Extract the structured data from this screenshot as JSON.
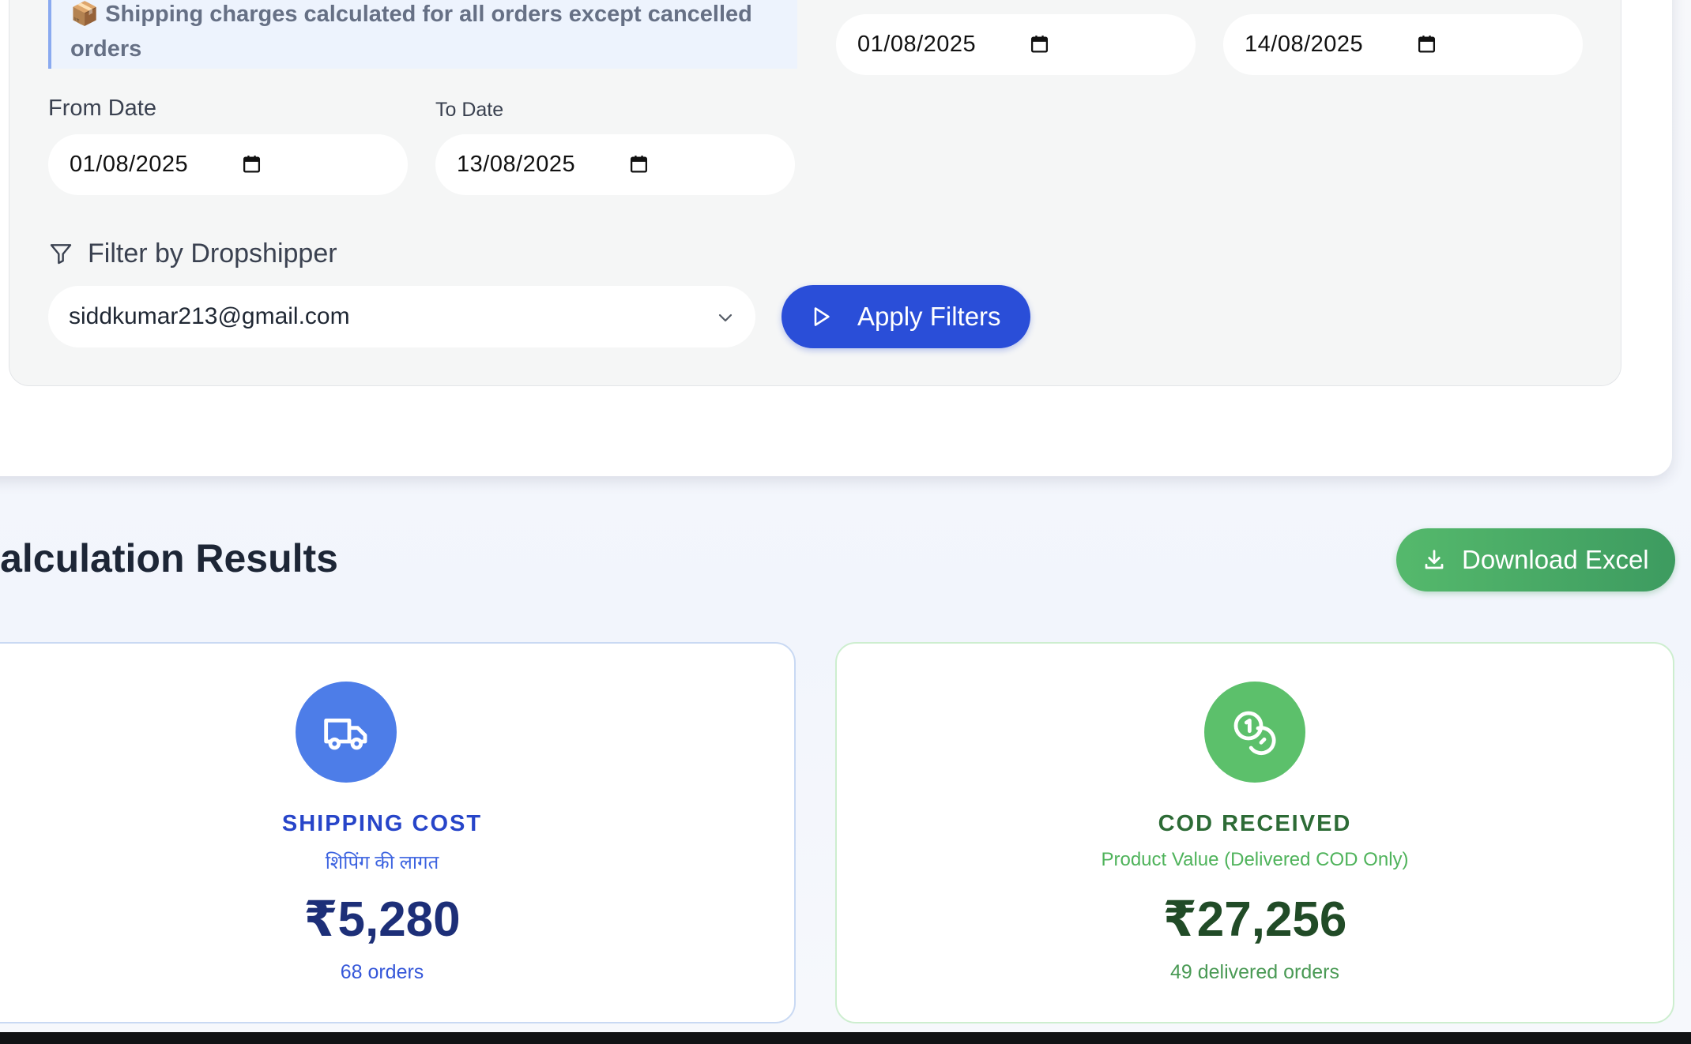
{
  "info_banner": {
    "text": "📦 Shipping charges calculated for all orders except cancelled orders"
  },
  "top_range": {
    "from_value": "01/08/2025",
    "to_value": "14/08/2025"
  },
  "date_range": {
    "from_label": "From Date",
    "from_value": "01/08/2025",
    "to_label": "To Date",
    "to_value": "13/08/2025"
  },
  "dropshipper_filter": {
    "label": "Filter by Dropshipper",
    "selected": "siddkumar213@gmail.com"
  },
  "apply_button": {
    "label": "Apply Filters"
  },
  "results": {
    "title": "Calculation Results",
    "download_label": "Download Excel"
  },
  "shipping_card": {
    "title": "SHIPPING COST",
    "subtitle": "शिपिंग की लागत",
    "value": "₹5,280",
    "count": "68 orders"
  },
  "cod_card": {
    "title": "COD RECEIVED",
    "subtitle": "Product Value (Delivered COD Only)",
    "value": "₹27,256",
    "count": "49 delivered orders"
  },
  "colors": {
    "primary_blue": "#2a4ed8",
    "success_green": "#55b96c",
    "shipping_icon_bg": "#4d7de8",
    "cod_icon_bg": "#5cc06b"
  },
  "icons": {
    "calendar": "calendar-icon",
    "filter": "filter-icon",
    "chevron": "chevron-down-icon",
    "play": "play-icon",
    "download": "download-icon",
    "truck": "truck-icon",
    "coins": "coins-icon"
  }
}
